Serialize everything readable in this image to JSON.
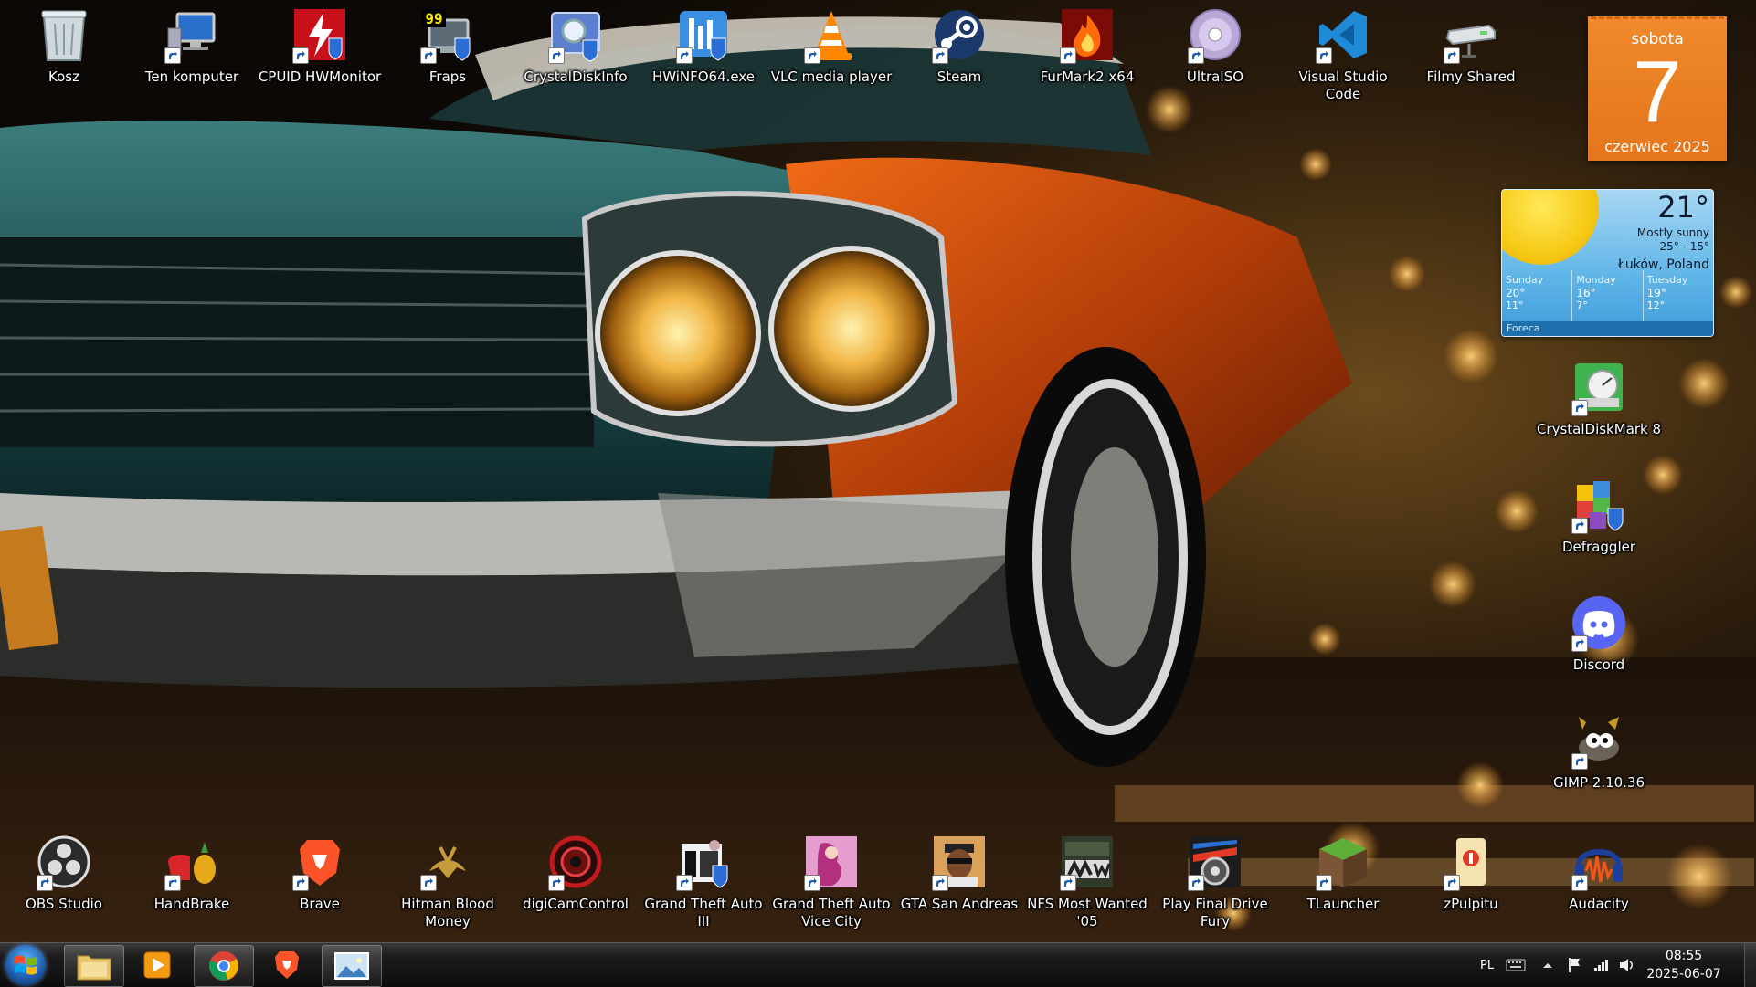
{
  "desktop": {
    "top_row": [
      {
        "id": "kosz",
        "label": "Kosz",
        "icon": "recycle-bin-icon"
      },
      {
        "id": "ten-komputer",
        "label": "Ten komputer",
        "icon": "computer-icon"
      },
      {
        "id": "hwmonitor",
        "label": "CPUID HWMonitor",
        "icon": "hwmonitor-icon"
      },
      {
        "id": "fraps",
        "label": "Fraps",
        "icon": "fraps-icon",
        "badge": "99"
      },
      {
        "id": "crystaldiskinfo",
        "label": "CrystalDiskInfo",
        "icon": "crystaldiskinfo-icon"
      },
      {
        "id": "hwinfo",
        "label": "HWiNFO64.exe",
        "icon": "hwinfo-icon"
      },
      {
        "id": "vlc",
        "label": "VLC media player",
        "icon": "vlc-icon"
      },
      {
        "id": "steam",
        "label": "Steam",
        "icon": "steam-icon"
      },
      {
        "id": "furmark",
        "label": "FurMark2 x64",
        "icon": "furmark-icon"
      },
      {
        "id": "ultraiso",
        "label": "UltraISO",
        "icon": "disc-icon"
      },
      {
        "id": "vscode",
        "label": "Visual Studio Code",
        "icon": "vscode-icon"
      },
      {
        "id": "filmy",
        "label": "Filmy Shared",
        "icon": "network-drive-icon"
      }
    ],
    "right_column": [
      {
        "id": "crystaldiskmark",
        "label": "CrystalDiskMark 8",
        "icon": "crystaldiskmark-icon"
      },
      {
        "id": "defraggler",
        "label": "Defraggler",
        "icon": "defraggler-icon"
      },
      {
        "id": "discord",
        "label": "Discord",
        "icon": "discord-icon"
      },
      {
        "id": "gimp",
        "label": "GIMP 2.10.36",
        "icon": "gimp-icon"
      }
    ],
    "bottom_row": [
      {
        "id": "obs",
        "label": "OBS Studio",
        "icon": "obs-icon"
      },
      {
        "id": "handbrake",
        "label": "HandBrake",
        "icon": "handbrake-icon"
      },
      {
        "id": "brave",
        "label": "Brave",
        "icon": "brave-icon"
      },
      {
        "id": "hitman",
        "label": "Hitman Blood Money",
        "icon": "hitman-icon"
      },
      {
        "id": "digicam",
        "label": "digiCamControl",
        "icon": "digicam-icon"
      },
      {
        "id": "gta3",
        "label": "Grand Theft Auto III",
        "icon": "gta3-icon"
      },
      {
        "id": "gtavc",
        "label": "Grand Theft Auto Vice City",
        "icon": "gta-vice-city-icon"
      },
      {
        "id": "gtasa",
        "label": "GTA San Andreas",
        "icon": "gta-san-andreas-icon"
      },
      {
        "id": "nfsmw",
        "label": "NFS Most Wanted '05",
        "icon": "nfs-most-wanted-icon"
      },
      {
        "id": "finaldrive",
        "label": "Play Final Drive Fury",
        "icon": "final-drive-fury-icon"
      },
      {
        "id": "tlauncher",
        "label": "TLauncher",
        "icon": "tlauncher-icon"
      },
      {
        "id": "zpulpitu",
        "label": "zPulpitu",
        "icon": "folder-icon"
      },
      {
        "id": "audacity",
        "label": "Audacity",
        "icon": "audacity-icon"
      }
    ]
  },
  "calendar_gadget": {
    "weekday": "sobota",
    "day": "7",
    "month_year": "czerwiec 2025"
  },
  "weather_gadget": {
    "temperature": "21°",
    "condition": "Mostly sunny",
    "range": "25° - 15°",
    "location": "Łuków, Poland",
    "forecast": [
      {
        "day": "Sunday",
        "high": "20°",
        "low": "11°"
      },
      {
        "day": "Monday",
        "high": "16°",
        "low": "7°"
      },
      {
        "day": "Tuesday",
        "high": "19°",
        "low": "12°"
      }
    ],
    "provider": "Foreca"
  },
  "taskbar": {
    "pinned": [
      "file-explorer-icon",
      "media-player-icon",
      "chrome-icon",
      "brave-icon",
      "photo-viewer-icon"
    ],
    "language": "PL",
    "time": "08:55",
    "date": "2025-06-07"
  },
  "colors": {
    "calendar_orange": "#e97d23",
    "weather_sky": "#5fb5e8",
    "taskbar": "#151515"
  }
}
